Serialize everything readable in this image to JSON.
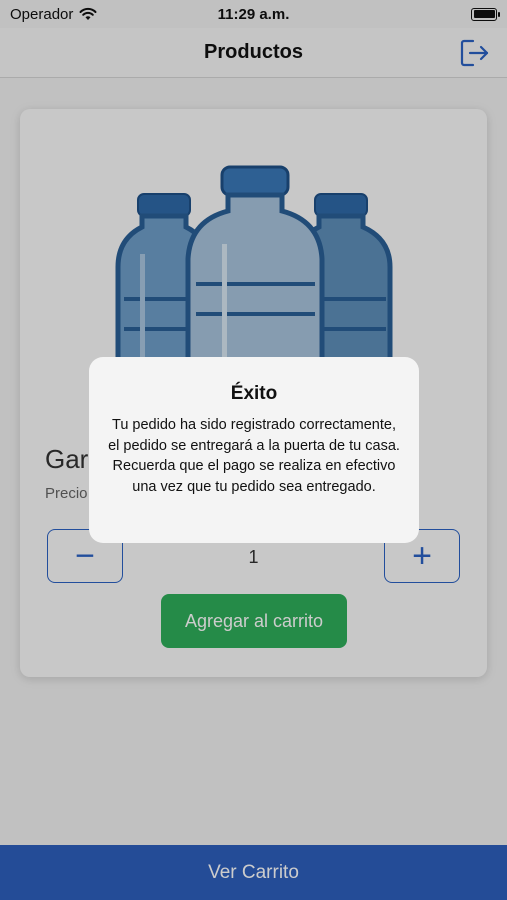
{
  "status_bar": {
    "carrier": "Operador",
    "time": "11:29 a.m.",
    "wifi_icon": "wifi-icon",
    "battery_icon": "battery-icon",
    "battery_level": 1.0
  },
  "navbar": {
    "title": "Productos",
    "logout_icon": "logout-icon"
  },
  "product": {
    "name": "Gar",
    "price_label": "Precio",
    "quantity": "1",
    "decrement_label": "−",
    "increment_label": "+",
    "add_to_cart_label": "Agregar al carrito",
    "image_icon": "water-bottles-image"
  },
  "bottom_bar": {
    "label": "Ver Carrito"
  },
  "alert": {
    "title": "Éxito",
    "message": "Tu pedido ha sido registrado correctamente, el pedido se entregará a la puerta de tu casa. Recuerda que el pago se realiza en efectivo una vez que tu pedido sea entregado."
  },
  "colors": {
    "accent_blue": "#2b62c4",
    "bottom_bar_blue": "#2d5fbd",
    "add_button_green": "#2fae5a",
    "bottle_blue": "#3a73ad"
  }
}
